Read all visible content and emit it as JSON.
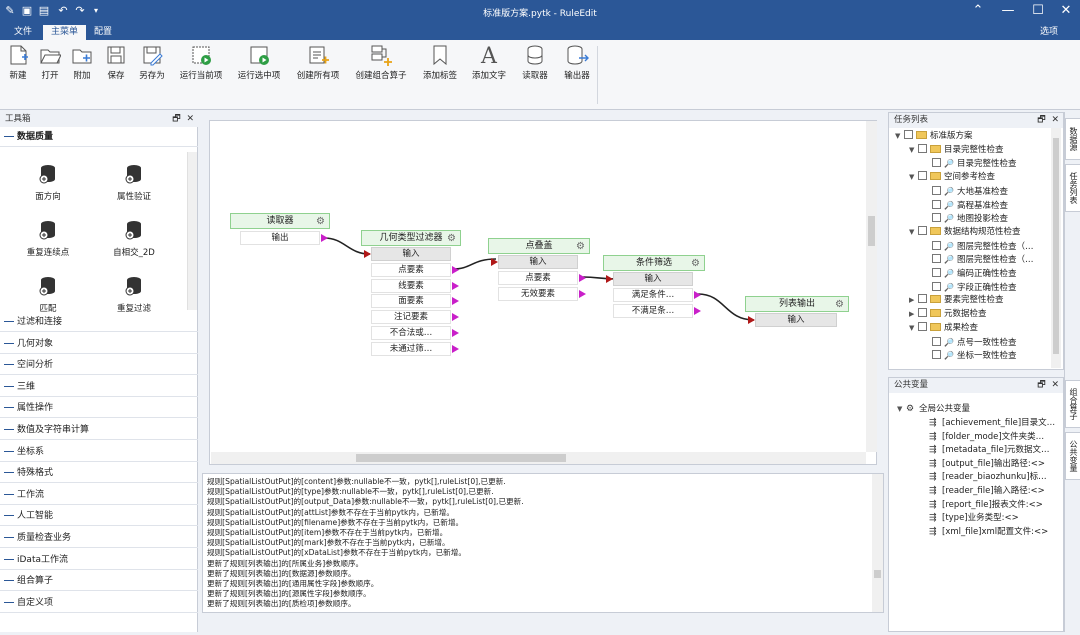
{
  "window": {
    "title": "标准版方案.pytk - RuleEdit"
  },
  "menu": {
    "tabs": [
      "文件",
      "主菜单",
      "配置"
    ],
    "options": "选项"
  },
  "ribbon": {
    "buttons": [
      "新建",
      "打开",
      "附加",
      "保存",
      "另存为",
      "运行当前项",
      "运行选中项",
      "创建所有项",
      "创建组合算子",
      "添加标签",
      "添加文字",
      "读取器",
      "输出器"
    ]
  },
  "toolbox": {
    "title": "工具箱",
    "active_group": "数据质量",
    "tools": [
      "面方向",
      "属性验证",
      "重复连续点",
      "自相交_2D",
      "匹配",
      "重复过滤"
    ],
    "groups": [
      "过滤和连接",
      "几何对象",
      "空间分析",
      "三维",
      "属性操作",
      "数值及字符串计算",
      "坐标系",
      "特殊格式",
      "工作流",
      "人工智能",
      "质量检查业务",
      "iData工作流",
      "组合算子",
      "自定义项"
    ]
  },
  "canvas": {
    "nodes": [
      {
        "title": "读取器",
        "outputs": [
          "输出"
        ],
        "inputs": []
      },
      {
        "title": "几何类型过滤器",
        "inputs": [
          "输入"
        ],
        "outputs": [
          "点要素",
          "线要素",
          "面要素",
          "注记要素",
          "不合法或…",
          "未通过筛…"
        ]
      },
      {
        "title": "点叠盖",
        "inputs": [
          "输入"
        ],
        "outputs": [
          "点要素",
          "无效要素"
        ]
      },
      {
        "title": "条件筛选",
        "inputs": [
          "输入"
        ],
        "outputs": [
          "满足条件…",
          "不满足条…"
        ]
      },
      {
        "title": "列表输出",
        "inputs": [
          "输入"
        ],
        "outputs": []
      }
    ]
  },
  "log": {
    "lines": [
      "规则[SpatialListOutPut]的[content]参数:nullable不一致，pytk[],ruleList[0],已更新.",
      "规则[SpatialListOutPut]的[type]参数:nullable不一致，pytk[],ruleList[0],已更新.",
      "规则[SpatialListOutPut]的[output_Data]参数:nullable不一致，pytk[],ruleList[0],已更新.",
      "规则[SpatialListOutPut]的[attList]参数不存在于当前pytk内，已新增。",
      "规则[SpatialListOutPut]的[filename]参数不存在于当前pytk内，已新增。",
      "规则[SpatialListOutPut]的[item]参数不存在于当前pytk内，已新增。",
      "规则[SpatialListOutPut]的[mark]参数不存在于当前pytk内，已新增。",
      "规则[SpatialListOutPut]的[xDataList]参数不存在于当前pytk内，已新增。",
      "更新了规则[列表输出]的[所属业务]参数顺序。",
      "更新了规则[列表输出]的[数据源]参数顺序。",
      "更新了规则[列表输出]的[通用属性字段]参数顺序。",
      "更新了规则[列表输出]的[源属性字段]参数顺序。",
      "更新了规则[列表输出]的[质检项]参数顺序。"
    ]
  },
  "tasks": {
    "title": "任务列表",
    "rows": [
      {
        "kind": "folder",
        "label": "标准版方案",
        "expanded": true
      },
      {
        "kind": "folder",
        "label": "目录完整性检查",
        "expanded": true
      },
      {
        "kind": "item",
        "label": "目录完整性检查"
      },
      {
        "kind": "folder",
        "label": "空间参考检查",
        "expanded": true
      },
      {
        "kind": "item",
        "label": "大地基准检查"
      },
      {
        "kind": "item",
        "label": "高程基准检查"
      },
      {
        "kind": "item",
        "label": "地图投影检查"
      },
      {
        "kind": "folder",
        "label": "数据结构规范性检查",
        "expanded": true
      },
      {
        "kind": "item",
        "label": "图层完整性检查（…"
      },
      {
        "kind": "item",
        "label": "图层完整性检查（…"
      },
      {
        "kind": "item",
        "label": "编码正确性检查"
      },
      {
        "kind": "item",
        "label": "字段正确性检查"
      },
      {
        "kind": "folder",
        "label": "要素完整性检查",
        "expanded": false
      },
      {
        "kind": "folder",
        "label": "元数据检查",
        "expanded": false
      },
      {
        "kind": "folder",
        "label": "成果检查",
        "expanded": true
      },
      {
        "kind": "item",
        "label": "点号一致性检查"
      },
      {
        "kind": "item",
        "label": "坐标一致性检查"
      }
    ]
  },
  "vars": {
    "title": "公共变量",
    "root": "全局公共变量",
    "items": [
      "[achievement_file]目录文…",
      "[folder_mode]文件夹类…",
      "[metadata_file]元数据文…",
      "[output_file]输出路径:<>",
      "[reader_biaozhunku]标…",
      "[reader_file]输入路径:<>",
      "[report_file]报表文件:<>",
      "[type]业务类型:<>",
      "[xml_file]xml配置文件:<>"
    ]
  },
  "side_tabs": [
    "数据源",
    "任务列表",
    "组合算子",
    "公共变量"
  ]
}
